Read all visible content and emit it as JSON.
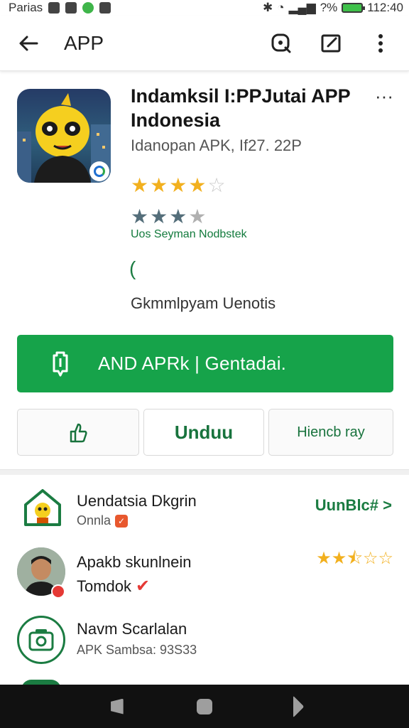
{
  "status_bar": {
    "carrier": "Parias",
    "battery_percent": "?%",
    "time": "112:40"
  },
  "app_bar": {
    "title": "APP",
    "back_icon": "arrow-left-icon",
    "search_icon": "search-icon",
    "edit_icon": "edit-icon",
    "menu_icon": "more-vert-icon"
  },
  "app": {
    "title": "Indamksil I:PPJutai APP Indonesia",
    "subtitle": "Idanopan APK, If27. 22P",
    "rating_primary": 4,
    "rating_secondary": 3,
    "review_label": "Uos Seyman Nodbstek",
    "bracket": "(",
    "description": "Gkmmlpyam Uenotis"
  },
  "install": {
    "label": "AND APRk | Gentadai."
  },
  "actions": {
    "share_icon": "thumbs-up-icon",
    "download_label": "Unduu",
    "third_label": "Hiencb ray"
  },
  "list": [
    {
      "title": "Uendatsia Dkgrin",
      "subtitle": "Onnla",
      "action": "UunBlc# >",
      "icon": "house-icon"
    },
    {
      "title": "Apakb skunlnein",
      "subtitle": "Tomdok",
      "rating": 2.5,
      "icon": "avatar"
    },
    {
      "title": "Navm Scarlalan",
      "subtitle": "APK Sambsa: 93S33",
      "icon": "camera-icon"
    }
  ],
  "colors": {
    "accent_green": "#16a34a",
    "text_green": "#1b7c42",
    "star_gold": "#f2b01e"
  }
}
